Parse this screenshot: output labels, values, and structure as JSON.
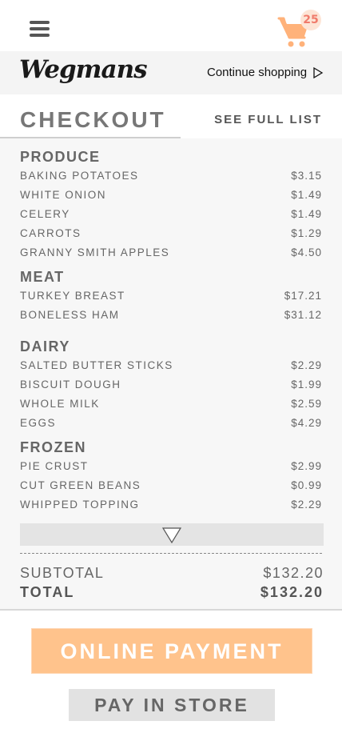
{
  "header": {
    "cart_count": "25",
    "cart_color": "#ffb27a",
    "badge_text_color": "#f07b6b"
  },
  "brand": {
    "logo": "Wegmans",
    "continue_label": "Continue shopping"
  },
  "checkout": {
    "title": "CHECKOUT",
    "see_full_list": "SEE FULL LIST",
    "categories": [
      {
        "name": "PRODUCE",
        "items": [
          {
            "name": "BAKING POTATOES",
            "price": "$3.15"
          },
          {
            "name": "WHITE ONION",
            "price": "$1.49"
          },
          {
            "name": "CELERY",
            "price": "$1.49"
          },
          {
            "name": "CARROTS",
            "price": "$1.29"
          },
          {
            "name": "GRANNY SMITH APPLES",
            "price": "$4.50"
          }
        ]
      },
      {
        "name": "MEAT",
        "items": [
          {
            "name": "TURKEY BREAST",
            "price": "$17.21"
          },
          {
            "name": "BONELESS HAM",
            "price": "$31.12"
          }
        ]
      },
      {
        "name": "DAIRY",
        "items": [
          {
            "name": "SALTED BUTTER STICKS",
            "price": "$2.29"
          },
          {
            "name": "BISCUIT DOUGH",
            "price": "$1.99"
          },
          {
            "name": "WHOLE MILK",
            "price": "$2.59"
          },
          {
            "name": "EGGS",
            "price": "$4.29"
          }
        ]
      },
      {
        "name": "FROZEN",
        "items": [
          {
            "name": "PIE CRUST",
            "price": "$2.99"
          },
          {
            "name": "CUT GREEN BEANS",
            "price": "$0.99"
          },
          {
            "name": "WHIPPED TOPPING",
            "price": "$2.29"
          }
        ]
      }
    ],
    "subtotal_label": "SUBTOTAL",
    "subtotal_value": "$132.20",
    "total_label": "TOTAL",
    "total_value": "$132.20"
  },
  "actions": {
    "online_payment": "ONLINE PAYMENT",
    "pay_in_store": "PAY IN STORE",
    "online_color": "#ffc38c",
    "store_color": "#e2e2e2"
  }
}
